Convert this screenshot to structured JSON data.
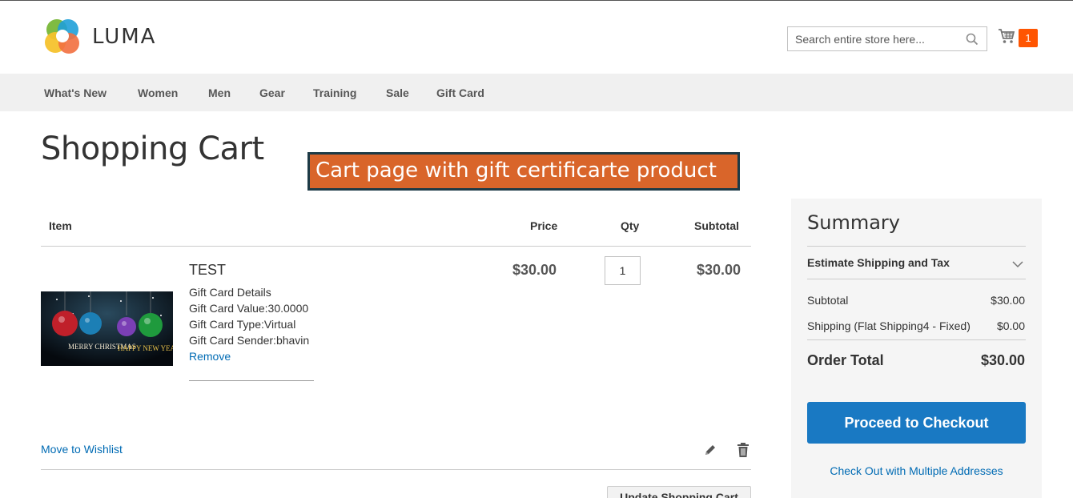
{
  "brand": {
    "name": "LUMA"
  },
  "search": {
    "placeholder": "Search entire store here..."
  },
  "minicart": {
    "count": "1"
  },
  "nav": {
    "items": [
      "What's New",
      "Women",
      "Men",
      "Gear",
      "Training",
      "Sale",
      "Gift Card"
    ]
  },
  "page": {
    "title": "Shopping Cart",
    "banner": "Cart page with gift certificarte product"
  },
  "cart": {
    "headers": {
      "item": "Item",
      "price": "Price",
      "qty": "Qty",
      "subtotal": "Subtotal"
    },
    "product": {
      "name": "TEST",
      "options": [
        "Gift Card Details",
        "Gift Card Value:30.0000",
        "Gift Card Type:Virtual",
        "Gift Card Sender:bhavin"
      ],
      "remove_label": "Remove",
      "price": "$30.00",
      "qty": "1",
      "subtotal": "$30.00",
      "image_text_1": "MERRY CHRISTMAS",
      "image_text_2": "HAPPY NEW YEAR"
    },
    "move_to_wishlist": "Move to Wishlist",
    "update_label": "Update Shopping Cart"
  },
  "summary": {
    "title": "Summary",
    "estimate_label": "Estimate Shipping and Tax",
    "subtotal_label": "Subtotal",
    "subtotal_value": "$30.00",
    "shipping_label": "Shipping (Flat Shipping4 - Fixed)",
    "shipping_value": "$0.00",
    "order_total_label": "Order Total",
    "order_total_value": "$30.00",
    "checkout_label": "Proceed to Checkout",
    "multi_address_label": "Check Out with Multiple Addresses"
  },
  "colors": {
    "accent": "#1979c3",
    "link": "#006bb4",
    "cart_badge": "#ff5501",
    "banner": "#d9652a"
  },
  "icons": [
    "search-icon",
    "cart-icon",
    "chevron-down-icon",
    "edit-icon",
    "trash-icon"
  ]
}
